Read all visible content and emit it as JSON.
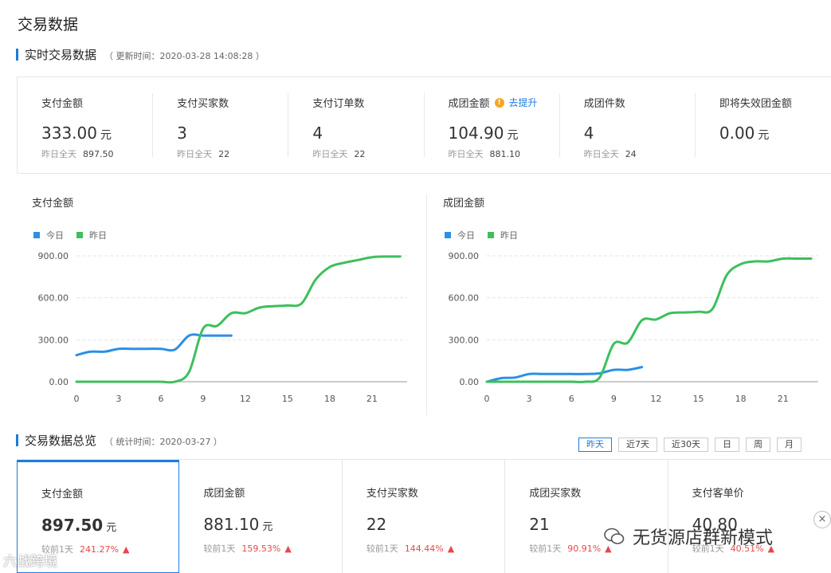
{
  "page": {
    "title": "交易数据"
  },
  "realtime": {
    "section_title": "实时交易数据",
    "updated_at": "（ 更新时间：2020-03-28 14:08:28 ）",
    "boost_link": "去提升",
    "cards": [
      {
        "label": "支付金额",
        "value": "333.00",
        "unit": "元",
        "sub_label": "昨日全天",
        "sub_value": "897.50"
      },
      {
        "label": "支付买家数",
        "value": "3",
        "unit": "",
        "sub_label": "昨日全天",
        "sub_value": "22"
      },
      {
        "label": "支付订单数",
        "value": "4",
        "unit": "",
        "sub_label": "昨日全天",
        "sub_value": "22"
      },
      {
        "label": "成团金额",
        "value": "104.90",
        "unit": "元",
        "sub_label": "昨日全天",
        "sub_value": "881.10"
      },
      {
        "label": "成团件数",
        "value": "4",
        "unit": "",
        "sub_label": "昨日全天",
        "sub_value": "24"
      },
      {
        "label": "即将失效团金额",
        "value": "0.00",
        "unit": "元",
        "sub_label": "",
        "sub_value": ""
      }
    ]
  },
  "colors": {
    "today": "#2b8fe6",
    "yesterday": "#3dbf5c",
    "accent": "#1f7ae0",
    "up": "#e5484d",
    "warn": "#f5a623"
  },
  "chart_data": [
    {
      "type": "line",
      "title": "支付金额",
      "x_ticks": [
        0,
        3,
        6,
        9,
        12,
        15,
        18,
        21
      ],
      "y_ticks": [
        "0.00",
        "300.00",
        "600.00",
        "900.00"
      ],
      "ylim": [
        0,
        900
      ],
      "xlim": [
        0,
        23.5
      ],
      "grid": true,
      "legend_position": "top-left",
      "series": [
        {
          "name": "今日",
          "color": "#2b8fe6",
          "points": [
            [
              0,
              190
            ],
            [
              1,
              215
            ],
            [
              2,
              215
            ],
            [
              3,
              235
            ],
            [
              4,
              235
            ],
            [
              5,
              235
            ],
            [
              6,
              235
            ],
            [
              7,
              230
            ],
            [
              8,
              330
            ],
            [
              9,
              330
            ],
            [
              10,
              330
            ],
            [
              11,
              330
            ]
          ]
        },
        {
          "name": "昨日",
          "color": "#3dbf5c",
          "points": [
            [
              0,
              0
            ],
            [
              1,
              0
            ],
            [
              2,
              0
            ],
            [
              3,
              0
            ],
            [
              4,
              0
            ],
            [
              5,
              0
            ],
            [
              6,
              0
            ],
            [
              7,
              0
            ],
            [
              8,
              70
            ],
            [
              9,
              380
            ],
            [
              10,
              400
            ],
            [
              11,
              490
            ],
            [
              12,
              490
            ],
            [
              13,
              530
            ],
            [
              14,
              540
            ],
            [
              15,
              545
            ],
            [
              16,
              560
            ],
            [
              17,
              730
            ],
            [
              18,
              820
            ],
            [
              19,
              850
            ],
            [
              20,
              870
            ],
            [
              21,
              890
            ],
            [
              22,
              895
            ],
            [
              23,
              895
            ]
          ]
        }
      ]
    },
    {
      "type": "line",
      "title": "成团金额",
      "x_ticks": [
        0,
        3,
        6,
        9,
        12,
        15,
        18,
        21
      ],
      "y_ticks": [
        "0.00",
        "300.00",
        "600.00",
        "900.00"
      ],
      "ylim": [
        0,
        900
      ],
      "xlim": [
        0,
        23.5
      ],
      "grid": true,
      "legend_position": "top-left",
      "series": [
        {
          "name": "今日",
          "color": "#2b8fe6",
          "points": [
            [
              0,
              0
            ],
            [
              1,
              25
            ],
            [
              2,
              30
            ],
            [
              3,
              55
            ],
            [
              4,
              55
            ],
            [
              5,
              55
            ],
            [
              6,
              55
            ],
            [
              7,
              55
            ],
            [
              8,
              60
            ],
            [
              9,
              85
            ],
            [
              10,
              85
            ],
            [
              11,
              105
            ]
          ]
        },
        {
          "name": "昨日",
          "color": "#3dbf5c",
          "points": [
            [
              0,
              0
            ],
            [
              1,
              0
            ],
            [
              2,
              0
            ],
            [
              3,
              0
            ],
            [
              4,
              0
            ],
            [
              5,
              0
            ],
            [
              6,
              0
            ],
            [
              7,
              0
            ],
            [
              8,
              30
            ],
            [
              9,
              270
            ],
            [
              10,
              280
            ],
            [
              11,
              440
            ],
            [
              12,
              445
            ],
            [
              13,
              490
            ],
            [
              14,
              495
            ],
            [
              15,
              500
            ],
            [
              16,
              520
            ],
            [
              17,
              760
            ],
            [
              18,
              840
            ],
            [
              19,
              860
            ],
            [
              20,
              860
            ],
            [
              21,
              880
            ],
            [
              22,
              880
            ],
            [
              23,
              880
            ]
          ]
        }
      ]
    }
  ],
  "overview": {
    "section_title": "交易数据总览",
    "stat_time": "（ 统计时间：2020-03-27 ）",
    "range_tabs": [
      "昨天",
      "近7天",
      "近30天",
      "日",
      "周",
      "月"
    ],
    "active_tab": 0,
    "cards": [
      {
        "label": "支付金额",
        "value": "897.50",
        "unit": "元",
        "compare_label": "较前1天",
        "compare_pct": "241.27%"
      },
      {
        "label": "成团金额",
        "value": "881.10",
        "unit": "元",
        "compare_label": "较前1天",
        "compare_pct": "159.53%"
      },
      {
        "label": "支付买家数",
        "value": "22",
        "unit": "",
        "compare_label": "较前1天",
        "compare_pct": "144.44%"
      },
      {
        "label": "成团买家数",
        "value": "21",
        "unit": "",
        "compare_label": "较前1天",
        "compare_pct": "90.91%"
      },
      {
        "label": "支付客单价",
        "value": "40.80",
        "unit": "",
        "compare_label": "较前1天",
        "compare_pct": "40.51%"
      }
    ],
    "close_icon": "×"
  },
  "watermark": {
    "text": "无货源店群新模式",
    "left_text": "六战跨境"
  }
}
